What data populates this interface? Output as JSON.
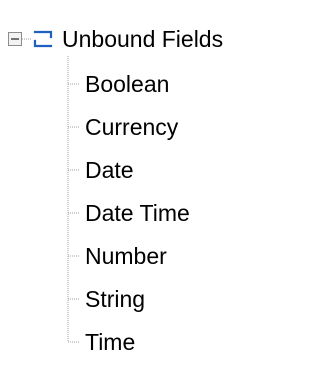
{
  "tree": {
    "root": {
      "label": "Unbound Fields",
      "expander_icon": "minus-box-icon",
      "node_icon": "bracket-field-icon",
      "expanded": true
    },
    "children": [
      {
        "label": "Boolean"
      },
      {
        "label": "Currency"
      },
      {
        "label": "Date"
      },
      {
        "label": "Date Time"
      },
      {
        "label": "Number"
      },
      {
        "label": "String"
      },
      {
        "label": "Time"
      }
    ]
  },
  "colors": {
    "text": "#000000",
    "connector": "#a0a0a0",
    "expander_border": "#8c8c8c",
    "expander_fill": "#f3f3f3",
    "icon_stroke": "#1f5fbf"
  }
}
